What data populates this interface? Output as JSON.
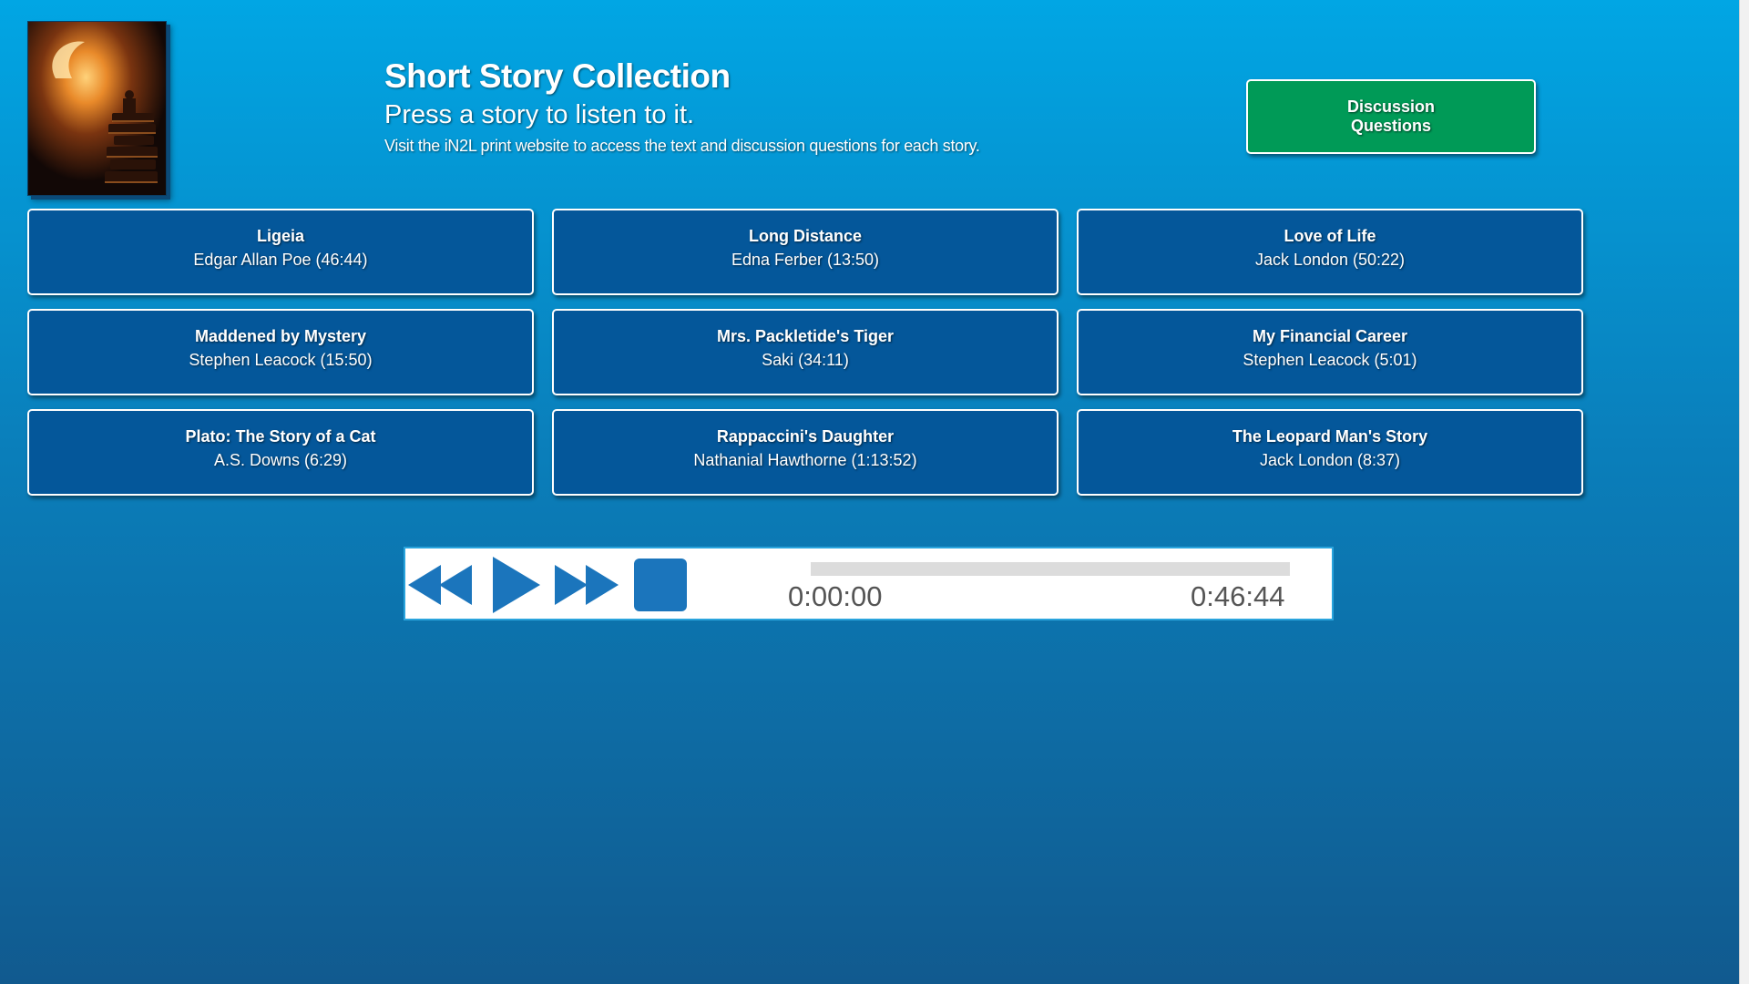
{
  "header": {
    "title": "Short Story Collection",
    "subtitle": "Press a story to listen to it.",
    "note": "Visit the iN2L print website to access the text and discussion questions for each story."
  },
  "discussion_button": {
    "label": "Discussion Questions"
  },
  "stories": [
    {
      "title": "Ligeia",
      "author_duration": "Edgar Allan Poe (46:44)"
    },
    {
      "title": "Long Distance",
      "author_duration": "Edna Ferber (13:50)"
    },
    {
      "title": "Love of Life",
      "author_duration": "Jack London (50:22)"
    },
    {
      "title": "Maddened by Mystery",
      "author_duration": "Stephen Leacock (15:50)"
    },
    {
      "title": "Mrs. Packletide's Tiger",
      "author_duration": "Saki (34:11)"
    },
    {
      "title": "My Financial Career",
      "author_duration": "Stephen Leacock (5:01)"
    },
    {
      "title": "Plato: The Story of a Cat",
      "author_duration": "A.S. Downs (6:29)"
    },
    {
      "title": "Rappaccini's Daughter",
      "author_duration": "Nathanial Hawthorne (1:13:52)"
    },
    {
      "title": "The Leopard Man's Story",
      "author_duration": "Jack London (8:37)"
    }
  ],
  "player": {
    "current_time": "0:00:00",
    "total_time": "0:46:44",
    "progress_fraction": 0,
    "controls": [
      "rewind-icon",
      "play-icon",
      "fast-forward-icon",
      "stop-icon"
    ]
  },
  "colors": {
    "background_top": "#01a6e4",
    "background_bottom": "#115a8f",
    "story_button": "#04579a",
    "discussion_button": "#009a57",
    "player_icon": "#1b75bc"
  }
}
